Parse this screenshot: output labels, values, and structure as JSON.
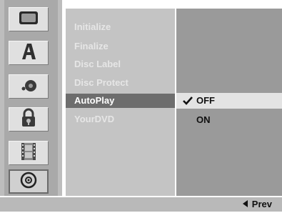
{
  "sidebar": {
    "icons": [
      {
        "name": "tv-icon"
      },
      {
        "name": "language-a-icon"
      },
      {
        "name": "audio-icon"
      },
      {
        "name": "lock-icon"
      },
      {
        "name": "film-icon"
      },
      {
        "name": "disc-icon",
        "selected": true
      }
    ]
  },
  "menu": {
    "items": [
      {
        "label": "Initialize",
        "active": false
      },
      {
        "label": "Finalize",
        "active": false
      },
      {
        "label": "Disc Label",
        "active": false
      },
      {
        "label": "Disc Protect",
        "active": false
      },
      {
        "label": "AutoPlay",
        "active": true
      },
      {
        "label": "YourDVD",
        "active": false
      }
    ]
  },
  "options": {
    "items": [
      {
        "label": "OFF",
        "checked": true
      },
      {
        "label": "ON",
        "checked": false
      }
    ]
  },
  "footer": {
    "prev_label": "Prev"
  },
  "colors": {
    "menu_active_bg": "#6d6d6d",
    "option_selected_bg": "#e3e3e3"
  }
}
